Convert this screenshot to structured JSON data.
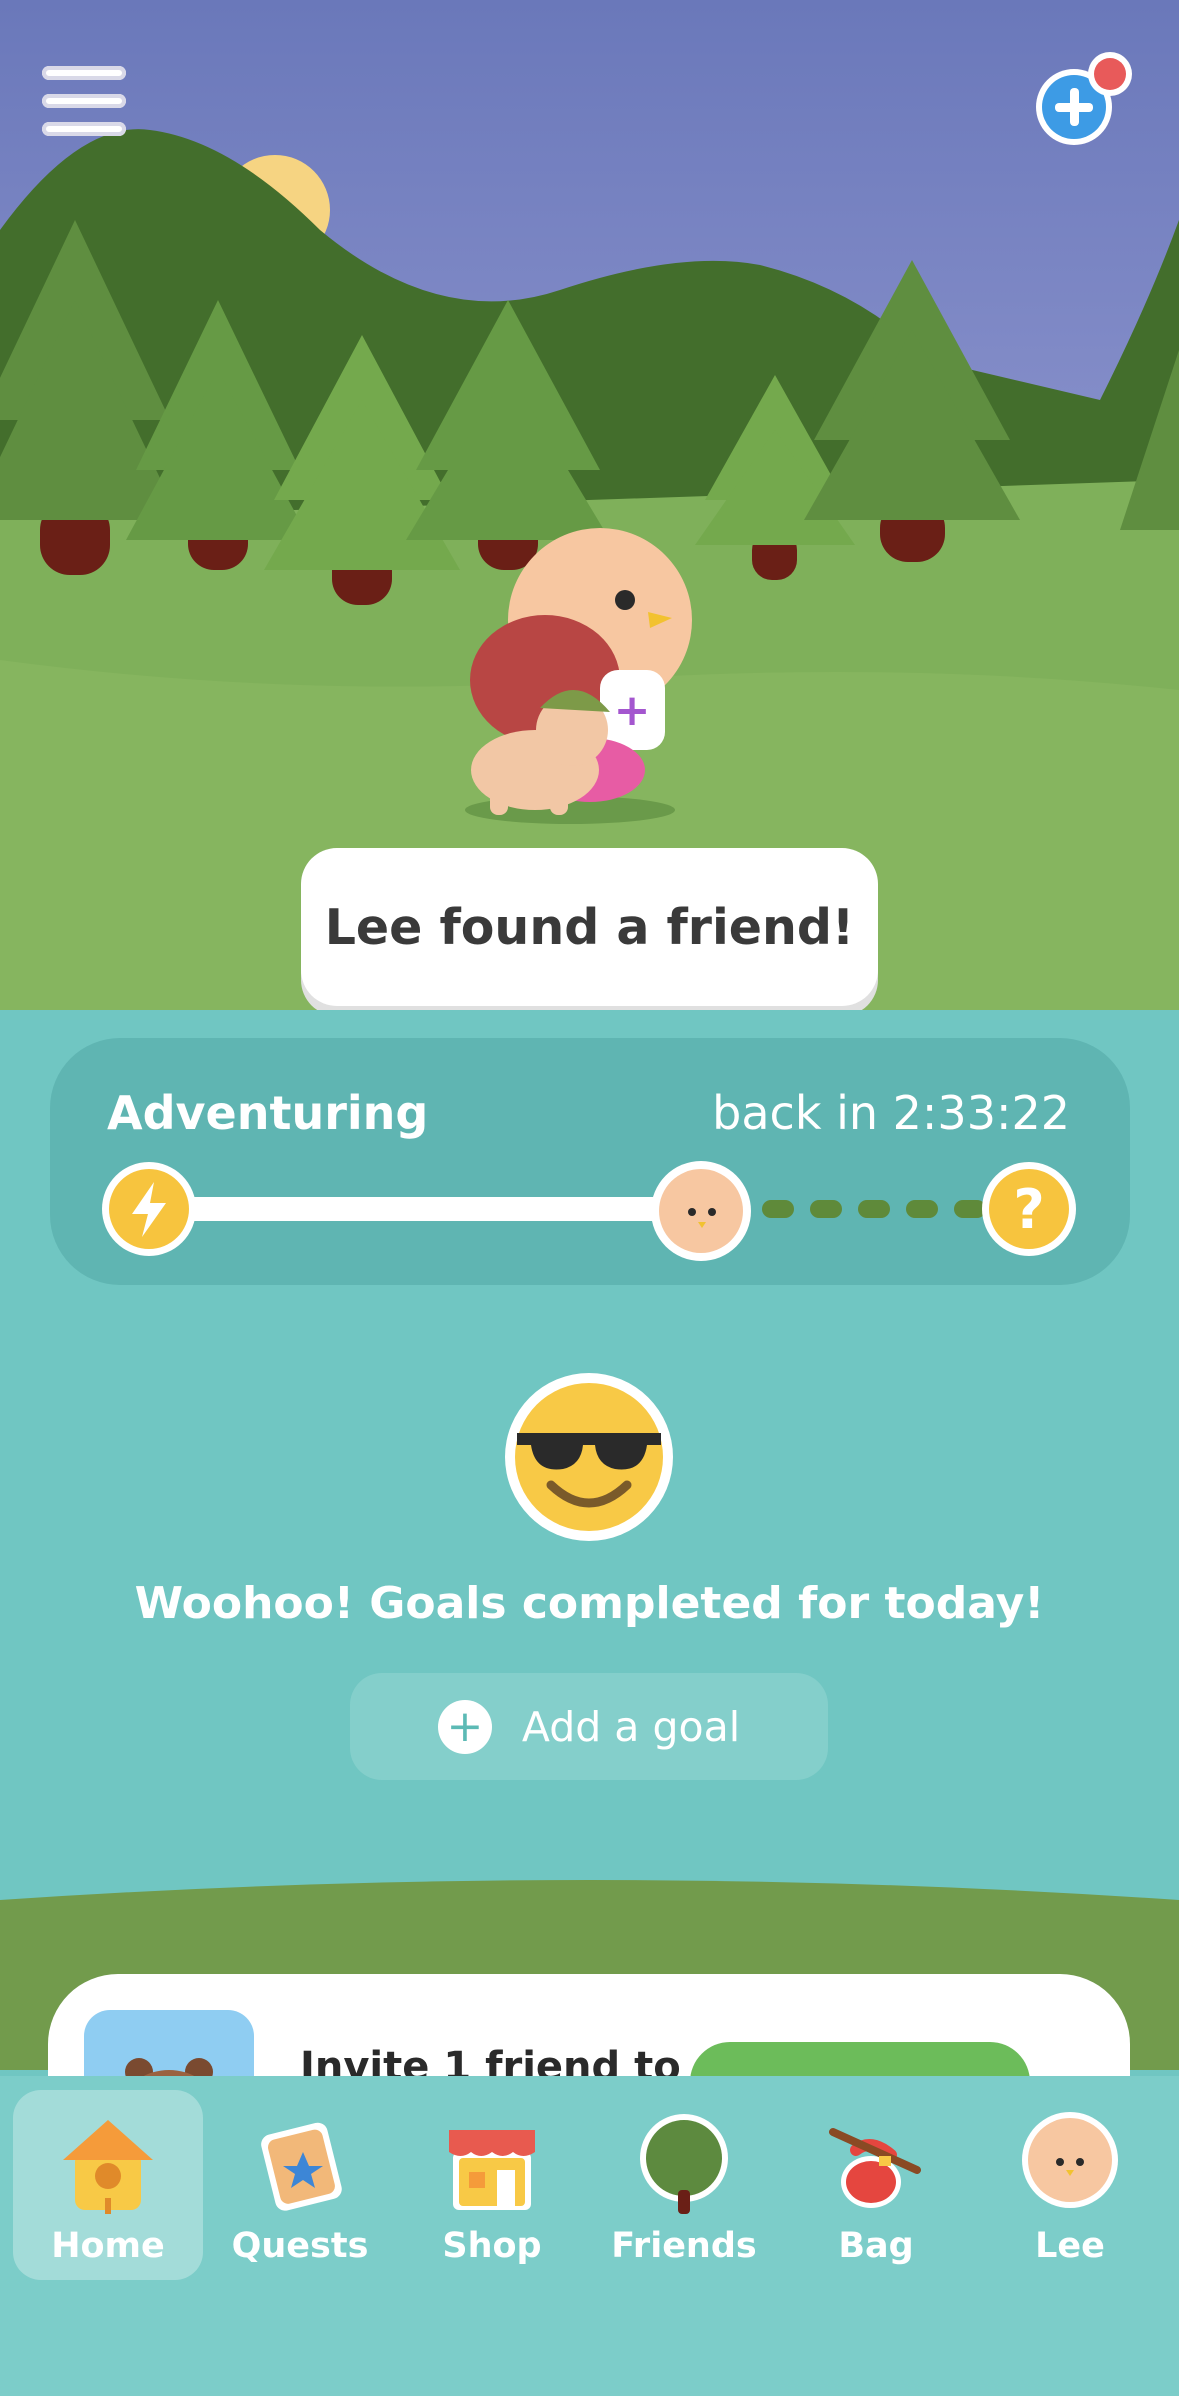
{
  "scene": {
    "speech_bubble": "Lee found a friend!"
  },
  "status": {
    "label": "Adventuring",
    "time_remaining": "back in 2:33:22",
    "progress_fraction": 0.58,
    "end_icon": "question-mark-icon"
  },
  "goals": {
    "message": "Woohoo! Goals completed for today!",
    "add_label": "Add a goal"
  },
  "invite": {
    "text": "Invite 1 friend to"
  },
  "nav": {
    "items": [
      {
        "label": "Home",
        "icon": "birdhouse-icon",
        "active": true
      },
      {
        "label": "Quests",
        "icon": "quest-board-icon",
        "active": false
      },
      {
        "label": "Shop",
        "icon": "shop-icon",
        "active": false
      },
      {
        "label": "Friends",
        "icon": "tree-icon",
        "active": false
      },
      {
        "label": "Bag",
        "icon": "bag-icon",
        "active": false
      },
      {
        "label": "Lee",
        "icon": "avatar-icon",
        "active": false
      }
    ]
  },
  "colors": {
    "teal_bg": "#70c6c2",
    "sky": "#6f7bbf",
    "grass": "#7fb05a",
    "accent_yellow": "#f7c43e"
  }
}
